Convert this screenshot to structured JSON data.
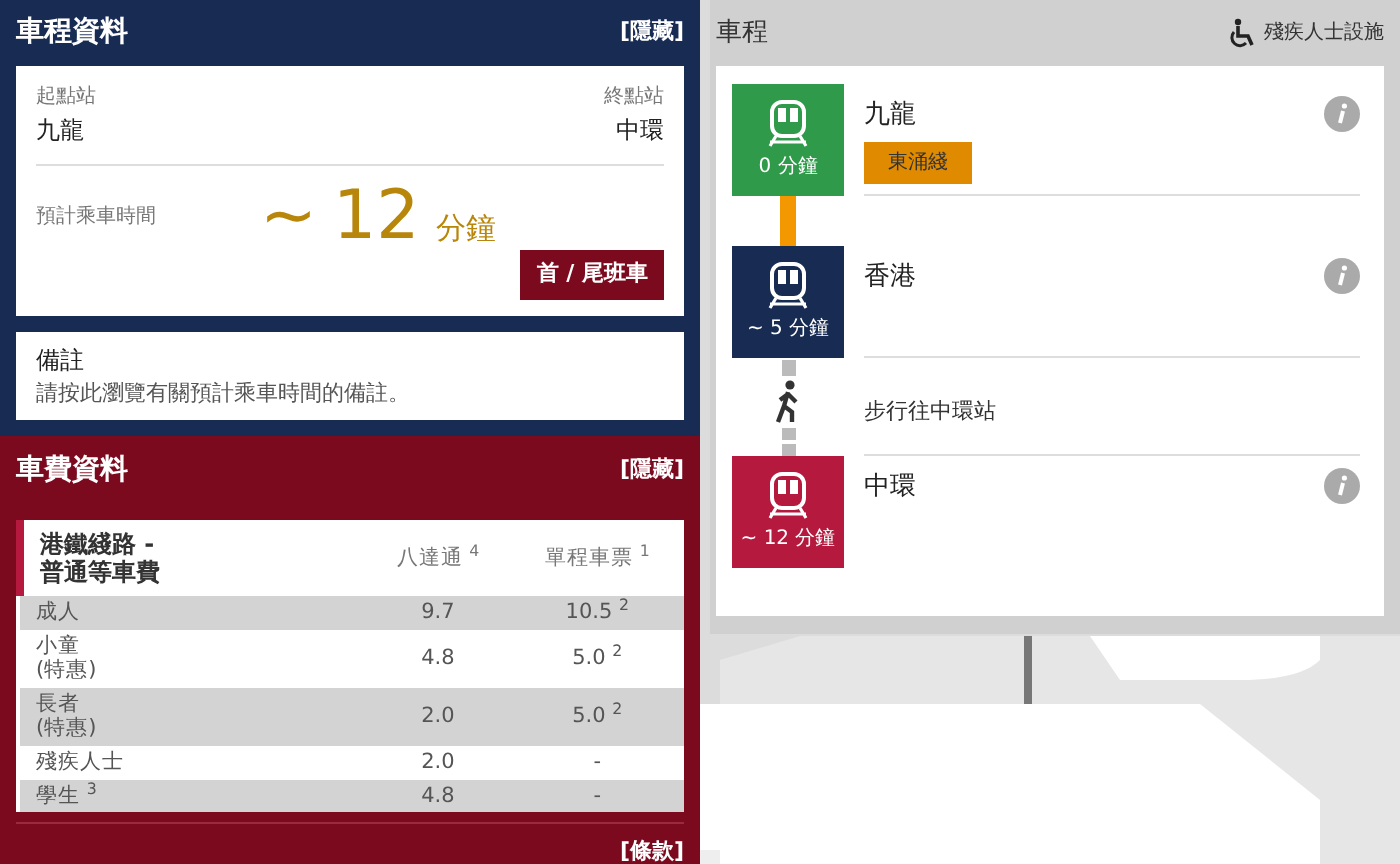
{
  "trip_info": {
    "title": "車程資料",
    "toggle": "[隱藏]",
    "from_label": "起點站",
    "from": "九龍",
    "to_label": "終點站",
    "to": "中環",
    "duration_label": "預計乘車時間",
    "duration_prefix": "~",
    "duration_value": "12",
    "duration_unit": "分鐘",
    "button": "首 / 尾班車",
    "remarks_title": "備註",
    "remarks_text": "請按此瀏覽有關預計乘車時間的備註。"
  },
  "fare_info": {
    "title": "車費資料",
    "toggle": "[隱藏]",
    "columns": [
      "港鐵綫路 -\n普通等車費",
      "八達通 $^{4}$",
      "單程車票 $^{1}$"
    ],
    "rows": [
      [
        "成人",
        "9.7",
        "10.5 $^{2}$"
      ],
      [
        "小童\n(特惠)",
        "4.8",
        "5.0 $^{2}$"
      ],
      [
        "長者\n(特惠)",
        "2.0",
        "5.0 $^{2}$"
      ],
      [
        "殘疾人士",
        "2.0",
        "-"
      ],
      [
        "學生 $^{3}$",
        "4.8",
        "-"
      ]
    ],
    "footer": "[條款]"
  },
  "journey": {
    "title": "車程",
    "accessibility": "殘疾人士設施",
    "items": [
      {
        "kind": "station",
        "name": "九龍",
        "time": "0 分鐘",
        "color": "#2e9a4a",
        "line": {
          "label": "東涌綫",
          "color": "#e08a00"
        }
      },
      {
        "kind": "rail",
        "color": "#f39800"
      },
      {
        "kind": "station",
        "name": "香港",
        "time": "~ 5 分鐘",
        "color": "#172b53"
      },
      {
        "kind": "walk",
        "text": "步行往中環站"
      },
      {
        "kind": "station",
        "name": "中環",
        "time": "~ 12 分鐘",
        "color": "#b5193e"
      }
    ]
  }
}
